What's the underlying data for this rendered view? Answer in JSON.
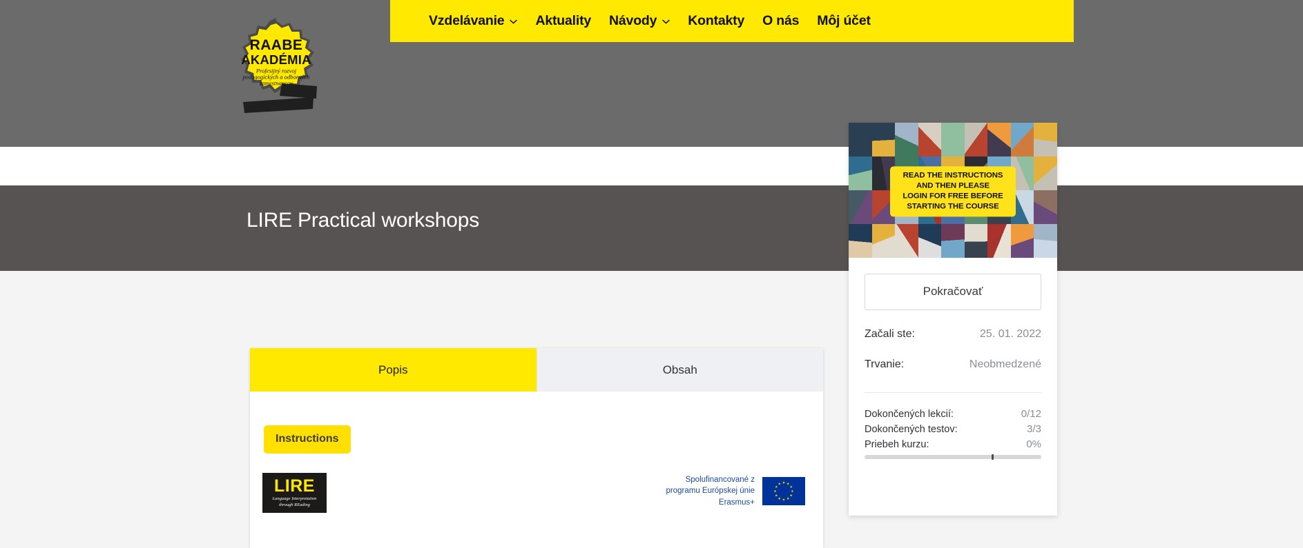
{
  "header": {
    "logo": {
      "name": "raabe-akademia-logo",
      "line1": "RAABE",
      "line2": "AKADÉMIA",
      "tagline_1": "Profesijný rozvoj",
      "tagline_2": "pedagogických a odborných",
      "tagline_3": "zamestnancov",
      "badge_color": "#ffe900",
      "text_color": "#111111"
    },
    "nav": {
      "background": "#ffe900",
      "items": [
        {
          "label": "Vzdelávanie",
          "has_dropdown": true,
          "icon": "chevron-down-icon"
        },
        {
          "label": "Aktuality",
          "has_dropdown": false,
          "icon": ""
        },
        {
          "label": "Návody",
          "has_dropdown": true,
          "icon": "chevron-down-icon"
        },
        {
          "label": "Kontakty",
          "has_dropdown": false,
          "icon": ""
        },
        {
          "label": "O nás",
          "has_dropdown": false,
          "icon": ""
        },
        {
          "label": "Môj účet",
          "has_dropdown": false,
          "icon": ""
        }
      ]
    }
  },
  "page": {
    "title": "LIRE Practical workshops",
    "title_band_color": "#575352",
    "header_band_color": "#6b6b6b",
    "body_background": "#f4f4f4"
  },
  "content": {
    "tabs": [
      {
        "label": "Popis",
        "active": true
      },
      {
        "label": "Obsah",
        "active": false
      }
    ],
    "instructions_button": "Instructions",
    "lire_logo": {
      "word": "LIRE",
      "subtitle_line1": "Language Interpretation",
      "subtitle_line2": "through REading"
    },
    "erasmus": {
      "line1": "Spolufinancované z",
      "line2": "programu Európskej únie",
      "line3": "Erasmus+",
      "flag_color": "#003399",
      "star_color": "#ffcc00"
    }
  },
  "sidebar": {
    "thumbnail": {
      "name": "course-thumbnail",
      "banner_line1": "READ THE INSTRUCTIONS",
      "banner_line2": "AND THEN PLEASE",
      "banner_line3": "LOGIN FOR FREE BEFORE",
      "banner_line4": "STARTING THE COURSE",
      "banner_color": "#ffe21a"
    },
    "continue_button": "Pokračovať",
    "meta": [
      {
        "label": "Začali ste:",
        "value": "25. 01. 2022"
      },
      {
        "label": "Trvanie:",
        "value": "Neobmedzené"
      }
    ],
    "stats": [
      {
        "label": "Dokončených lekcií:",
        "value": "0/12"
      },
      {
        "label": "Dokončených testov:",
        "value": "3/3"
      },
      {
        "label": "Priebeh kurzu:",
        "value": "0%"
      }
    ],
    "progress": {
      "percent": 0,
      "marker_position_percent": 72,
      "track_color": "#d6d7d9",
      "marker_color": "#4a4a4a"
    }
  }
}
